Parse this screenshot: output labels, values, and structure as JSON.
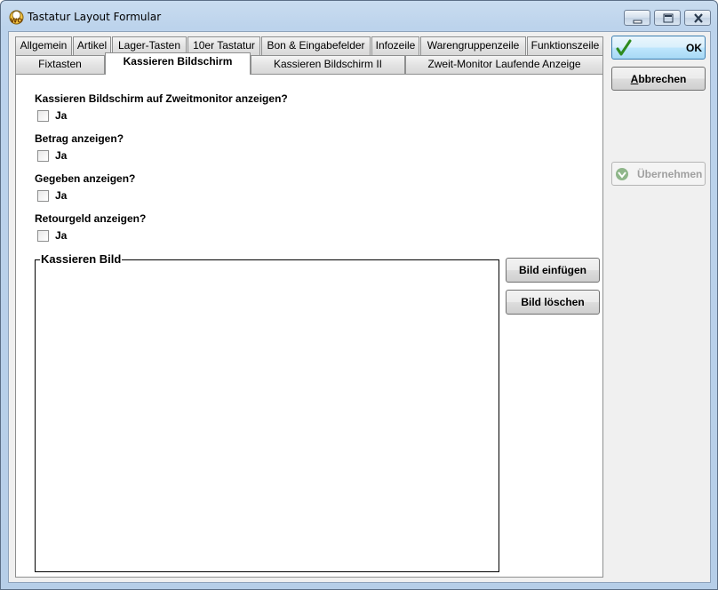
{
  "window": {
    "title": "Tastatur Layout Formular"
  },
  "tabs": {
    "row1": [
      {
        "label": "Allgemein"
      },
      {
        "label": "Artikel"
      },
      {
        "label": "Lager-Tasten"
      },
      {
        "label": "10er Tastatur"
      },
      {
        "label": "Bon & Eingabefelder"
      },
      {
        "label": "Infozeile"
      },
      {
        "label": "Warengruppenzeile"
      },
      {
        "label": "Funktionszeile"
      }
    ],
    "row2": [
      {
        "label": "Fixtasten"
      },
      {
        "label": "Kassieren Bildschirm"
      },
      {
        "label": "Kassieren Bildschirm II"
      },
      {
        "label": "Zweit-Monitor Laufende Anzeige"
      }
    ],
    "active": "Kassieren Bildschirm"
  },
  "panel": {
    "questions": [
      {
        "text": "Kassieren Bildschirm auf Zweitmonitor anzeigen?",
        "checkbox_label": "Ja",
        "checked": false
      },
      {
        "text": "Betrag anzeigen?",
        "checkbox_label": "Ja",
        "checked": false
      },
      {
        "text": "Gegeben anzeigen?",
        "checkbox_label": "Ja",
        "checked": false
      },
      {
        "text": "Retourgeld anzeigen?",
        "checkbox_label": "Ja",
        "checked": false
      }
    ],
    "image_group_title": "Kassieren Bild",
    "insert_image_label": "Bild einfügen",
    "delete_image_label": "Bild löschen"
  },
  "actions": {
    "ok_label": "OK",
    "cancel_label_underlined": "A",
    "cancel_label_rest": "bbrechen",
    "apply_label": "Übernehmen",
    "apply_enabled": false
  },
  "colors": {
    "accent_ok_border": "#3c7fb1",
    "check_green": "#2e8b1e",
    "disabled_text": "#a0a0a0"
  },
  "icons": {
    "app": "wo-app-icon",
    "minimize": "minimize-icon",
    "maximize": "maximize-icon",
    "close": "close-icon",
    "ok": "checkmark-icon",
    "apply": "apply-arrow-icon"
  }
}
